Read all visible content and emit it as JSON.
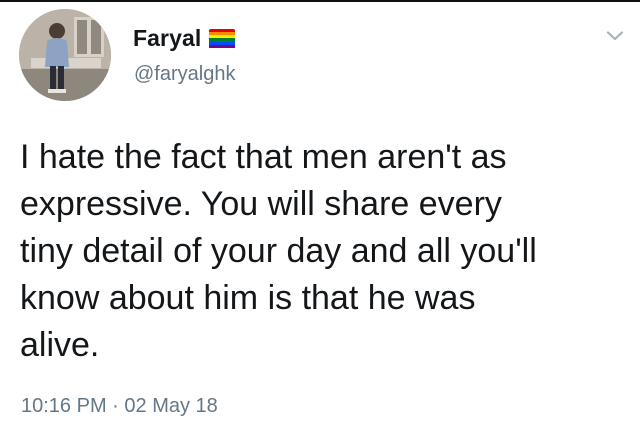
{
  "tweet": {
    "author_name": "Faryal",
    "author_badge": {
      "icon": "pride-flag-emoji",
      "colors": [
        "#e40303",
        "#ff8c00",
        "#ffed00",
        "#008026",
        "#004dff",
        "#750787"
      ]
    },
    "handle": "@faryalghk",
    "menu_icon": "chevron-down-icon",
    "text_lines": [
      "I hate the fact that men aren't as",
      "expressive. You will share every",
      "tiny detail of your day and all you'll",
      "know about him is that he was",
      "alive."
    ],
    "time": "10:16 PM",
    "separator": "·",
    "date": "02 May 18"
  },
  "colors": {
    "text": "#14171a",
    "secondary": "#657786",
    "background": "#ffffff"
  }
}
